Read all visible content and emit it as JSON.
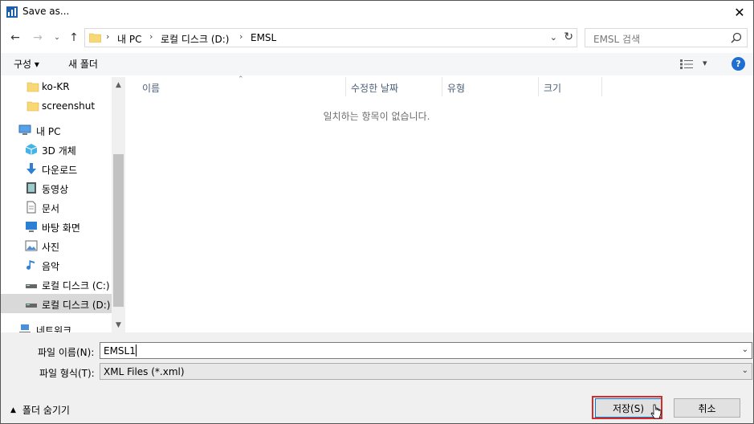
{
  "window": {
    "title": "Save as..."
  },
  "nav": {
    "breadcrumbs": [
      "내 PC",
      "로컬 디스크 (D:)",
      "EMSL"
    ],
    "search_placeholder": "EMSL 검색"
  },
  "toolbar": {
    "organize_label": "구성 ▾",
    "new_folder_label": "새 폴더"
  },
  "sidebar": {
    "items": [
      {
        "label": "ko-KR",
        "icon": "folder-icon"
      },
      {
        "label": "screenshut",
        "icon": "folder-icon"
      },
      {
        "label": "내 PC",
        "icon": "pc-icon"
      },
      {
        "label": "3D 개체",
        "icon": "cube-icon"
      },
      {
        "label": "다운로드",
        "icon": "download-icon"
      },
      {
        "label": "동영상",
        "icon": "video-icon"
      },
      {
        "label": "문서",
        "icon": "document-icon"
      },
      {
        "label": "바탕 화면",
        "icon": "desktop-icon"
      },
      {
        "label": "사진",
        "icon": "picture-icon"
      },
      {
        "label": "음악",
        "icon": "music-icon"
      },
      {
        "label": "로컬 디스크 (C:)",
        "icon": "drive-icon"
      },
      {
        "label": "로컬 디스크 (D:)",
        "icon": "drive-icon",
        "selected": true
      },
      {
        "label": "네트워크",
        "icon": "network-icon"
      }
    ]
  },
  "filelist": {
    "columns": [
      "이름",
      "수정한 날짜",
      "유형",
      "크기"
    ],
    "empty_message": "일치하는 항목이 없습니다."
  },
  "form": {
    "filename_label": "파일 이름(N):",
    "filename_value": "EMSL1",
    "filetype_label": "파일 형식(T):",
    "filetype_value": "XML Files (*.xml)"
  },
  "footer": {
    "hide_folders_label": "폴더 숨기기",
    "save_label": "저장(S)",
    "cancel_label": "취소"
  },
  "colors": {
    "accent": "#0078d7",
    "highlight_box": "#d62b2b",
    "help_icon": "#1e6fd1"
  }
}
